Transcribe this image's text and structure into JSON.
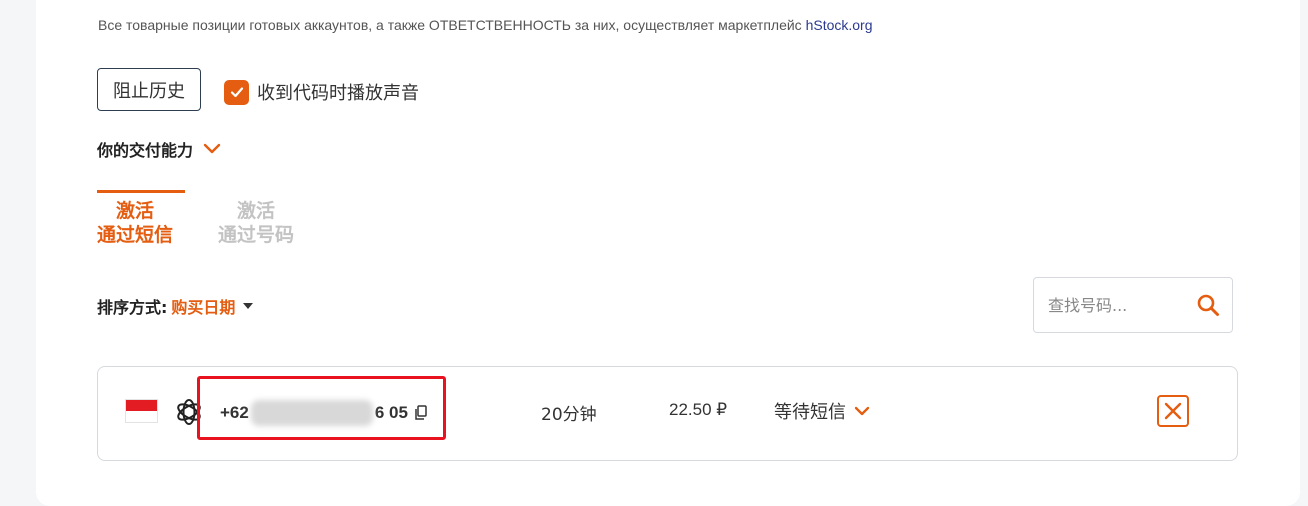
{
  "disclaimer": {
    "text": "Все товарные позиции готовых аккаунтов, а также ОТВЕТСТВЕННОСТЬ за них, осуществляет маркетплейс ",
    "link": "hStock.org"
  },
  "controls": {
    "block_history_label": "阻止历史",
    "sound_checkbox_label": "收到代码时播放声音",
    "sound_checked": true
  },
  "ability": {
    "label": "你的交付能力"
  },
  "tabs": [
    {
      "line1": "激活",
      "line2": "通过短信",
      "active": true
    },
    {
      "line1": "激活",
      "line2": "通过号码",
      "active": false
    }
  ],
  "sort": {
    "label": "排序方式:",
    "value": "购买日期"
  },
  "search": {
    "placeholder": "查找号码...",
    "value": ""
  },
  "activations": [
    {
      "country_flag": "flag-indonesia",
      "service_icon": "openai-icon",
      "phone_prefix": "+62",
      "phone_suffix": "6 05",
      "duration": "20分钟",
      "price": "22.50 ₽",
      "status": "等待短信"
    }
  ],
  "colors": {
    "accent": "#e45d10",
    "highlight_box": "#e8131e",
    "link": "#2b3a8f"
  }
}
